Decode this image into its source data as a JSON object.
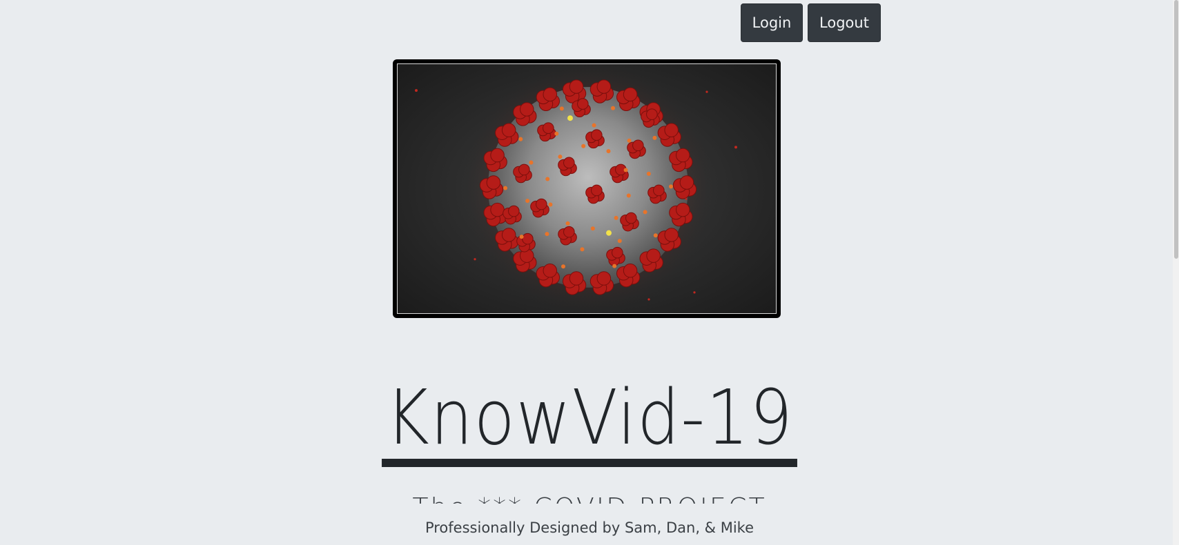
{
  "nav": {
    "login_label": "Login",
    "logout_label": "Logout"
  },
  "hero": {
    "image": "coronavirus-illustration"
  },
  "brand": {
    "title": "KnowVid-19",
    "tagline": "The *** COVID PROJECT"
  },
  "footer": {
    "credit": "Professionally Designed by Sam, Dan, & Mike"
  },
  "colors": {
    "background": "#e9ecef",
    "button": "#343a40",
    "text": "#212529",
    "virus_spike": "#c0201b"
  }
}
